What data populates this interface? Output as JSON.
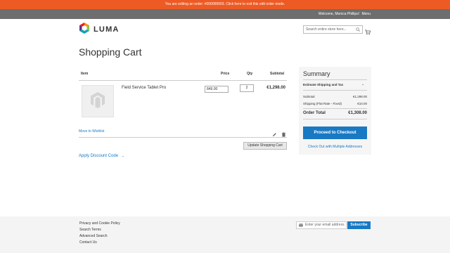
{
  "banner": {
    "text": "You are editing an order: #000000003. Click here to exit this edit order mode."
  },
  "header": {
    "welcome": "Welcome, Monica Phillips!",
    "menu_label": "Menu",
    "logo_text": "LUMA",
    "search_placeholder": "Search entire store here..."
  },
  "page": {
    "title": "Shopping Cart"
  },
  "cart": {
    "columns": {
      "item": "Item",
      "price": "Price",
      "qty": "Qty",
      "subtotal": "Subtotal"
    },
    "item": {
      "name": "Field Service Tablet Pro",
      "price_value": "849.00",
      "qty_value": "2",
      "subtotal": "€1,298.00"
    },
    "move_to_wishlist": "Move to Wishlist",
    "update_button": "Update Shopping Cart",
    "discount_label": "Apply Discount Code"
  },
  "summary": {
    "title": "Summary",
    "estimate_label": "Estimate Shipping and Tax",
    "rows": [
      {
        "label": "Subtotal",
        "value": "€1,298.00"
      },
      {
        "label": "Shipping (Flat Rate - Fixed)",
        "value": "€10.00"
      }
    ],
    "order_total_label": "Order Total",
    "order_total_value": "€1,308.00",
    "checkout_button": "Proceed to Checkout",
    "multi_address_link": "Check Out with Multiple Addresses"
  },
  "footer": {
    "links": [
      "Privacy and Cookie Policy",
      "Search Terms",
      "Advanced Search",
      "Contact Us"
    ],
    "newsletter_placeholder": "Enter your email address",
    "subscribe_button": "Subscribe"
  },
  "colors": {
    "banner": "#ee5a24",
    "accent": "#1979c3",
    "topbar": "#6e6e6e"
  },
  "icons": [
    "luma-logo-icon",
    "search-icon",
    "cart-icon",
    "product-placeholder-icon",
    "pencil-icon",
    "trash-icon",
    "chevron-down-icon",
    "envelope-icon"
  ]
}
